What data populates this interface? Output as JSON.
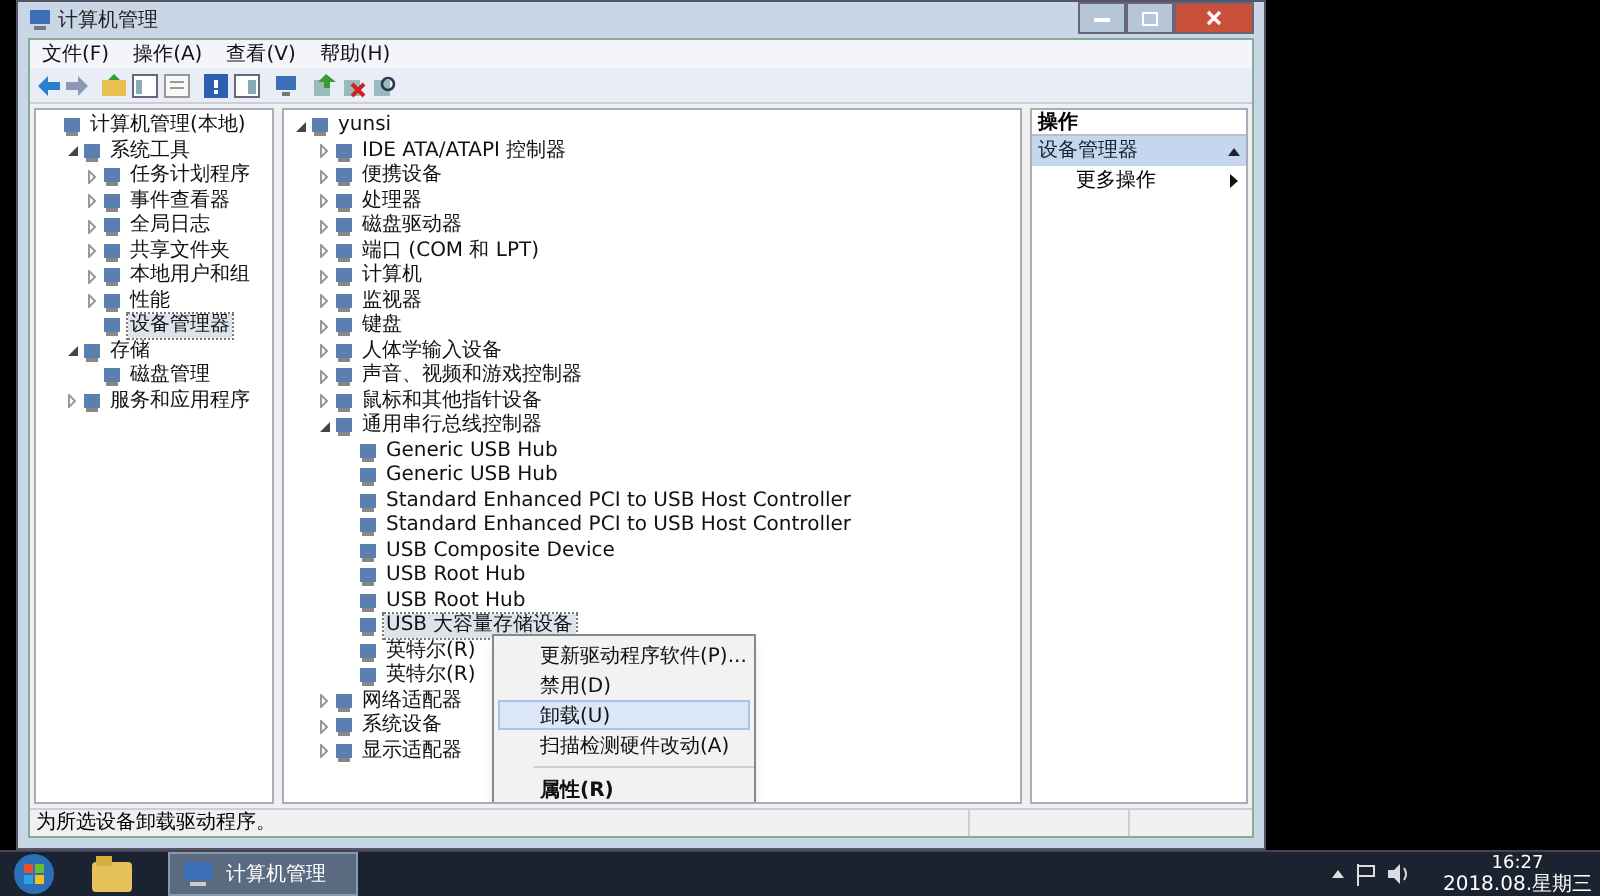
{
  "window": {
    "title": "计算机管理"
  },
  "menu": [
    "文件(F)",
    "操作(A)",
    "查看(V)",
    "帮助(H)"
  ],
  "left_tree": [
    {
      "label": "计算机管理(本地)",
      "selected": false,
      "children": [
        {
          "label": "系统工具",
          "expanded": true,
          "selected": false,
          "children": [
            {
              "label": "任务计划程序",
              "expanded": false,
              "selected": false
            },
            {
              "label": "事件查看器",
              "expanded": false,
              "selected": false
            },
            {
              "label": "全局日志",
              "expanded": false,
              "selected": false
            },
            {
              "label": "共享文件夹",
              "expanded": false,
              "selected": false
            },
            {
              "label": "本地用户和组",
              "expanded": false,
              "selected": false
            },
            {
              "label": "性能",
              "expanded": false,
              "selected": false
            },
            {
              "label": "设备管理器",
              "selected": true
            }
          ]
        },
        {
          "label": "存储",
          "expanded": true,
          "selected": false,
          "children": [
            {
              "label": "磁盘管理",
              "selected": false
            }
          ]
        },
        {
          "label": "服务和应用程序",
          "expanded": false,
          "selected": false
        }
      ]
    }
  ],
  "device_tree": [
    {
      "label": "yunsi",
      "expanded": true,
      "selected": false,
      "children": [
        {
          "label": "IDE ATA/ATAPI 控制器",
          "expanded": false,
          "selected": false
        },
        {
          "label": "便携设备",
          "expanded": false,
          "selected": false
        },
        {
          "label": "处理器",
          "expanded": false,
          "selected": false
        },
        {
          "label": "磁盘驱动器",
          "expanded": false,
          "selected": false
        },
        {
          "label": "端口 (COM 和 LPT)",
          "expanded": false,
          "selected": false
        },
        {
          "label": "计算机",
          "expanded": false,
          "selected": false
        },
        {
          "label": "监视器",
          "expanded": false,
          "selected": false
        },
        {
          "label": "键盘",
          "expanded": false,
          "selected": false
        },
        {
          "label": "人体学输入设备",
          "expanded": false,
          "selected": false
        },
        {
          "label": "声音、视频和游戏控制器",
          "expanded": false,
          "selected": false
        },
        {
          "label": "鼠标和其他指针设备",
          "expanded": false,
          "selected": false
        },
        {
          "label": "通用串行总线控制器",
          "expanded": true,
          "selected": false,
          "children": [
            {
              "label": "Generic USB Hub",
              "selected": false
            },
            {
              "label": "Generic USB Hub",
              "selected": false
            },
            {
              "label": "Standard Enhanced PCI to USB Host Controller",
              "selected": false
            },
            {
              "label": "Standard Enhanced PCI to USB Host Controller",
              "selected": false
            },
            {
              "label": "USB Composite Device",
              "selected": false
            },
            {
              "label": "USB Root Hub",
              "selected": false
            },
            {
              "label": "USB Root Hub",
              "selected": false
            },
            {
              "label": "USB 大容量存储设备",
              "selected": true
            },
            {
              "label": "英特尔(R)",
              "selected": false
            },
            {
              "label": "英特尔(R)",
              "selected": false
            }
          ]
        },
        {
          "label": "网络适配器",
          "expanded": false,
          "selected": false
        },
        {
          "label": "系统设备",
          "expanded": false,
          "selected": false
        },
        {
          "label": "显示适配器",
          "expanded": false,
          "selected": false
        }
      ]
    }
  ],
  "context_menu": [
    {
      "label": "更新驱动程序软件(P)...",
      "selected": false,
      "bold": false
    },
    {
      "label": "禁用(D)",
      "selected": false,
      "bold": false
    },
    {
      "label": "卸载(U)",
      "selected": true,
      "bold": false
    },
    {
      "label": "扫描检测硬件改动(A)",
      "selected": false,
      "bold": false,
      "separator_after": true
    },
    {
      "label": "属性(R)",
      "selected": false,
      "bold": true
    }
  ],
  "actions": {
    "header": "操作",
    "section": "设备管理器",
    "items": [
      "更多操作"
    ]
  },
  "status_bar": "为所选设备卸载驱动程序。",
  "taskbar": {
    "task": "计算机管理",
    "time": "16:27",
    "date": "2018.08.星期三"
  }
}
